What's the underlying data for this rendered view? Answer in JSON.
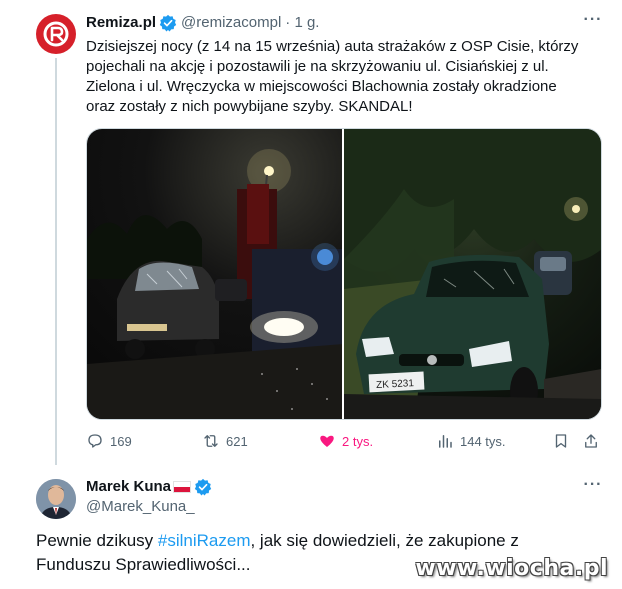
{
  "tweet1": {
    "author_name": "Remiza.pl",
    "author_handle": "@remizacompl",
    "time": "· 1 g.",
    "text": "Dzisiejszej nocy (z 14 na 15 września) auta strażaków z OSP Cisie, którzy pojechali na akcję i pozostawili je na skrzyżowaniu ul. Cisiańskiej z ul. Zielona i ul. Wręczycka w miejscowości Blachownia zostały okradzione oraz zostały z nich powybijane szyby. SKANDAL!",
    "photo2_plate": "ZK 5231",
    "stats": {
      "replies": "169",
      "reposts": "621",
      "likes": "2 tys.",
      "views": "144 tys."
    }
  },
  "tweet2": {
    "author_name": "Marek Kuna",
    "author_handle": "@Marek_Kuna_",
    "text_before": "Pewnie dzikusy ",
    "hashtag": "#silniRazem",
    "text_after": ", jak się dowiedzieli, że zakupione z Funduszu Sprawiedliwości..."
  },
  "watermark": "www.wiocha.pl",
  "colors": {
    "accent": "#1d9bf0",
    "like": "#f91880",
    "secondary_text": "#536471",
    "brand_red": "#d6202a"
  },
  "icons": {
    "verified": "verified-badge-icon",
    "more": "more-icon",
    "reply": "reply-icon",
    "repost": "repost-icon",
    "like": "heart-icon",
    "views": "views-icon",
    "bookmark": "bookmark-icon",
    "share": "share-icon"
  }
}
